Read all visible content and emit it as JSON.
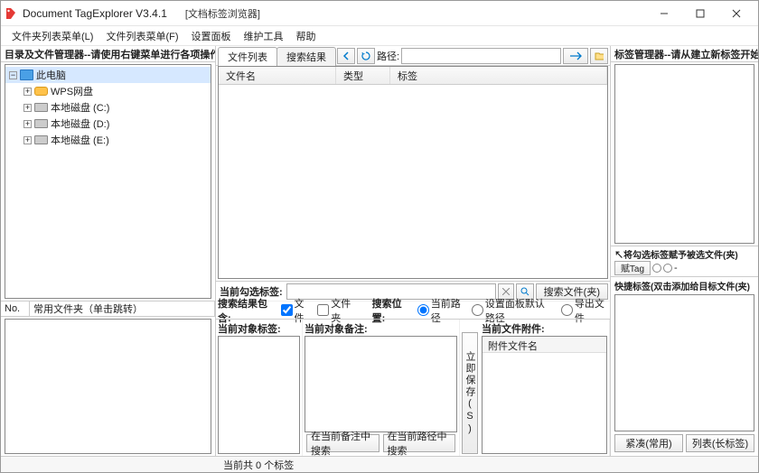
{
  "window": {
    "title": "Document TagExplorer  V3.4.1",
    "subtitle": "[文档标签浏览器]"
  },
  "menu": [
    "文件夹列表菜单(L)",
    "文件列表菜单(F)",
    "设置面板",
    "维护工具",
    "帮助"
  ],
  "left": {
    "header": "目录及文件管理器--请使用右键菜单进行各项操作…",
    "tree": [
      {
        "label": "此电脑",
        "icon": "monitor",
        "selected": true,
        "expanded": true,
        "depth": 0
      },
      {
        "label": "WPS网盘",
        "icon": "cloud",
        "depth": 1,
        "expandable": true
      },
      {
        "label": "本地磁盘 (C:)",
        "icon": "drive",
        "depth": 1,
        "expandable": true
      },
      {
        "label": "本地磁盘 (D:)",
        "icon": "drive",
        "depth": 1,
        "expandable": true
      },
      {
        "label": "本地磁盘 (E:)",
        "icon": "drive",
        "depth": 1,
        "expandable": true
      }
    ],
    "lower_cols": [
      "No.",
      "常用文件夹（单击跳转）"
    ]
  },
  "mid": {
    "tabs": [
      "文件列表",
      "搜索结果"
    ],
    "path_label": "路径:",
    "path_value": "",
    "headers": [
      "文件名",
      "类型",
      "标签"
    ],
    "sel_label": "当前勾选标签:",
    "sel_value": "",
    "search_btn": "搜索文件(夹)",
    "opt_label": "搜索结果包含:",
    "ck_file": "文件",
    "ck_folder": "文件夹",
    "pos_label": "搜索位置:",
    "pos_opts": [
      "当前路径",
      "设置面板默认路径",
      "导出文件"
    ],
    "low_titles": [
      "当前对象标签:",
      "当前对象备注:",
      "当前文件附件:"
    ],
    "attach_col": "附件文件名",
    "vert_btn": "立即保存(S)",
    "bot_btns": [
      "在当前备注中搜索",
      "在当前路径中搜索"
    ]
  },
  "right": {
    "header": "标签管理器--请从建立新标签开始…",
    "assign_label": "↖将勾选标签赋予被选文件(夹)",
    "assign_btn": "赋Tag",
    "quick_label": "快捷标签(双击添加给目标文件(夹)",
    "btn1": "紧凑(常用)",
    "btn2": "列表(长标签)"
  },
  "status": "当前共 0 个标签"
}
